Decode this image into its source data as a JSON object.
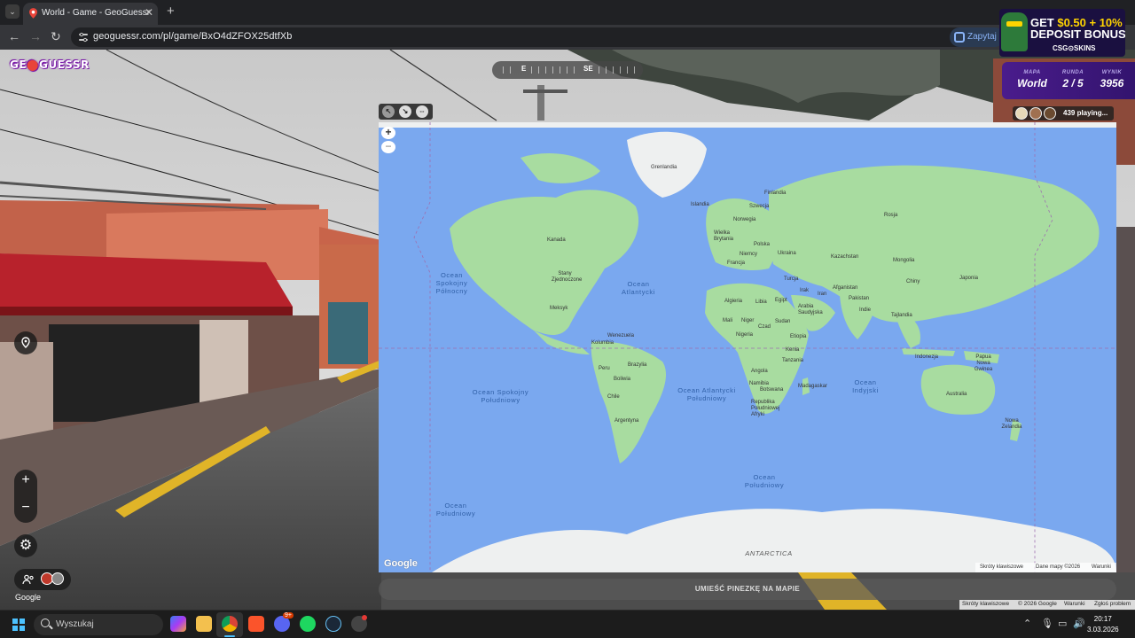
{
  "browser": {
    "tab_title": "World - Game - GeoGuessr",
    "new_tab": "+",
    "tab_close": "✕",
    "tab_menu": "⌄",
    "url": "geoguessr.com/pl/game/BxO4dZFOX25dtfXb",
    "ask_label": "Zapytaj G",
    "nav": {
      "back": "←",
      "forward": "→",
      "reload": "↻"
    }
  },
  "game": {
    "logo_left": "GE",
    "logo_pin": "⬤",
    "logo_right": "GUESSR",
    "compass": [
      "E",
      "SE"
    ],
    "status": {
      "map_label": "MAPA",
      "map_value": "World",
      "round_label": "RUNDA",
      "round_value": "2 / 5",
      "score_label": "WYNIK",
      "score_value": "3956"
    },
    "players_playing": "439 playing...",
    "place_button": "UMIEŚĆ PINEZKĘ NA MAPIE",
    "zoom_in": "+",
    "zoom_out": "−",
    "sv_google": "Google",
    "sv_attribution": [
      "Skróty klawiszowe",
      "© 2026 Google",
      "Warunki",
      "Zgłoś problem"
    ]
  },
  "ad": {
    "line1_a": "GET ",
    "line1_b": "$0.50 + 10%",
    "line2": "DEPOSIT BONUS",
    "brand": "CSG⊙SKINS"
  },
  "map": {
    "zoom_in": "+",
    "zoom_out": "−",
    "google": "Google",
    "attribution": [
      "Skróty klawiszowe",
      "Dane mapy ©2026",
      "Warunki"
    ],
    "countries": [
      "Grenlandia",
      "Islandia",
      "Finlandia",
      "Szwecja",
      "Norwegia",
      "Wielka Brytania",
      "Polska",
      "Niemcy",
      "Francja",
      "Ukraina",
      "Rosja",
      "Kazachstan",
      "Mongolia",
      "Turcja",
      "Chiny",
      "Japonia",
      "Irak",
      "Iran",
      "Afganistan",
      "Pakistan",
      "Indie",
      "Tajlandia",
      "Arabia Saudyjska",
      "Egipt",
      "Libia",
      "Algieria",
      "Mali",
      "Niger",
      "Czad",
      "Sudan",
      "Nigeria",
      "Etiopia",
      "Kenia",
      "Tanzania",
      "Angola",
      "Namibia",
      "Botswana",
      "Madagaskar",
      "Republika Południowej Afryki",
      "Kanada",
      "Stany Zjednoczone",
      "Meksyk",
      "Kolumbia",
      "Wenezuela",
      "Peru",
      "Brazylia",
      "Boliwia",
      "Chile",
      "Argentyna",
      "Indonezja",
      "Papua Nowa Gwinea",
      "Australia",
      "Nowa Zelandia"
    ],
    "oceans": [
      "Ocean Spokojny Północny",
      "Ocean Atlantycki",
      "Ocean Spokojny Południowy",
      "Ocean Atlantycki Południowy",
      "Ocean Indyjski",
      "Ocean Południowy",
      "Ocean Południowy"
    ],
    "antarctica": "ANTARCTICA"
  },
  "taskbar": {
    "search": "Wyszukaj",
    "badge": "9+",
    "time": "20:17",
    "date": "3.03.2026"
  },
  "colors": {
    "accent_purple": "#4a1c8c",
    "ocean": "#7aa8ef",
    "land": "#a8dca0",
    "ice": "#f2f3f4"
  }
}
